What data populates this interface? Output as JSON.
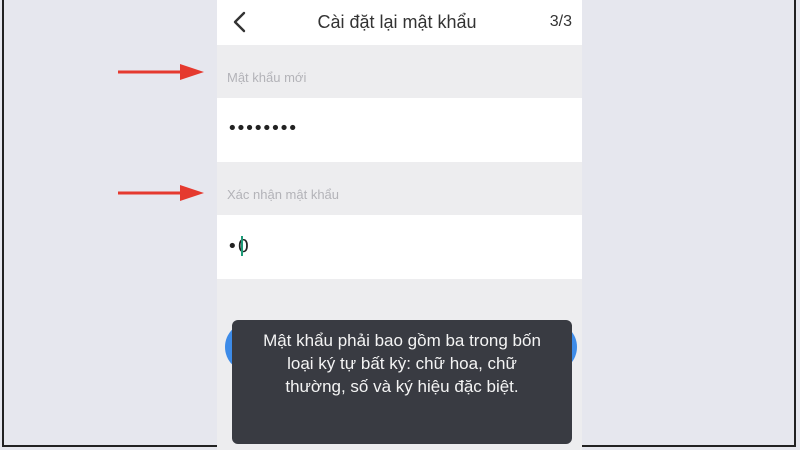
{
  "header": {
    "title": "Cài đặt lại mật khẩu",
    "step": "3/3"
  },
  "form": {
    "new_password_label": "Mật khẩu mới",
    "new_password_value": "••••••••",
    "confirm_password_label": "Xác nhận mật khẩu",
    "confirm_password_value": "•0"
  },
  "toast": {
    "message": "Mật khẩu phải bao gồm ba trong bốn loại ký tự bất kỳ: chữ hoa, chữ thường, số và ký hiệu đặc biệt."
  },
  "icons": {
    "back": "chevron-left-icon",
    "annotation": "red-arrow-icon"
  },
  "colors": {
    "annotation_arrow": "#e53a2f",
    "submit_button": "#3d8be8",
    "caret": "#1d9a78",
    "toast_background": "#393b42"
  }
}
